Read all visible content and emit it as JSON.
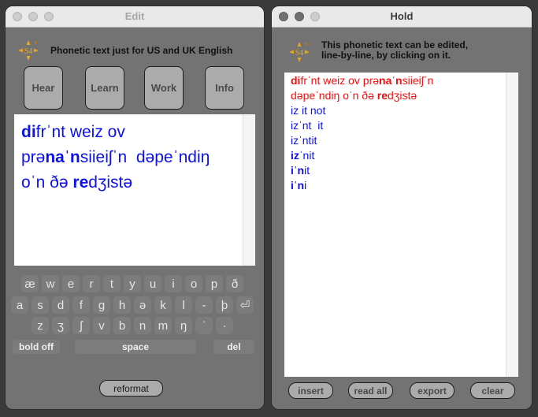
{
  "edit_window": {
    "title": "Edit",
    "logo_icon": "s4-compass-logo",
    "header_text": "Phonetic text  just for US and UK English",
    "buttons": [
      "Hear",
      "Learn",
      "Work",
      "Info"
    ],
    "text_lines": [
      [
        {
          "t": "di",
          "b": true
        },
        {
          "t": "frˈnt weiz ov",
          "b": false
        }
      ],
      [
        {
          "t": "prə",
          "b": false
        },
        {
          "t": "naˈn",
          "b": true
        },
        {
          "t": "siieiʃˈn  dəpeˈndiŋ",
          "b": false
        }
      ],
      [
        {
          "t": "oˈn ðə ",
          "b": false
        },
        {
          "t": "re",
          "b": true
        },
        {
          "t": "dʒistə",
          "b": false
        }
      ]
    ],
    "keyboard": {
      "row1": [
        "æ",
        "w",
        "e",
        "r",
        "t",
        "y",
        "u",
        "i",
        "o",
        "p",
        "ð"
      ],
      "row2": [
        "a",
        "s",
        "d",
        "f",
        "g",
        "h",
        "ə",
        "k",
        "l",
        "-",
        "þ",
        "⏎"
      ],
      "row3": [
        "z",
        "ʒ",
        "ʃ",
        "v",
        "b",
        "n",
        "m",
        "ŋ",
        "ˈ",
        "·"
      ],
      "bold_off": "bold off",
      "space": "space",
      "del": "del"
    },
    "reformat_label": "reformat"
  },
  "hold_window": {
    "title": "Hold",
    "logo_icon": "s4-compass-logo",
    "header_line1": "This phonetic text can be edited,",
    "header_line2": "line-by-line, by clicking on it.",
    "lines": [
      {
        "color": "red",
        "parts": [
          {
            "t": "di",
            "b": true
          },
          {
            "t": "frˈnt weiz ov prə",
            "b": false
          },
          {
            "t": "naˈn",
            "b": true
          },
          {
            "t": "siieiʃˈn",
            "b": false
          }
        ]
      },
      {
        "color": "red",
        "parts": [
          {
            "t": "dəpeˈndiŋ oˈn ðə ",
            "b": false
          },
          {
            "t": "re",
            "b": true
          },
          {
            "t": "dʒistə",
            "b": false
          }
        ]
      },
      {
        "color": "blue",
        "parts": [
          {
            "t": "iz it not",
            "b": false
          }
        ]
      },
      {
        "color": "blue",
        "parts": [
          {
            "t": "izˈnt  it",
            "b": false
          }
        ]
      },
      {
        "color": "blue",
        "parts": [
          {
            "t": "izˈntit",
            "b": false
          }
        ]
      },
      {
        "color": "blue",
        "parts": [
          {
            "t": "iz",
            "b": true
          },
          {
            "t": "ˈnit",
            "b": false
          }
        ]
      },
      {
        "color": "blue",
        "parts": [
          {
            "t": "iˈn",
            "b": true
          },
          {
            "t": "it",
            "b": false
          }
        ]
      },
      {
        "color": "blue",
        "parts": [
          {
            "t": "iˈn",
            "b": true
          },
          {
            "t": "i",
            "b": false
          }
        ]
      }
    ],
    "buttons": [
      "insert",
      "read all",
      "export",
      "clear"
    ]
  },
  "colors": {
    "phonetic_blue": "#0d12e8",
    "phonetic_red": "#ee1111",
    "logo_gold": "#e8a620"
  }
}
